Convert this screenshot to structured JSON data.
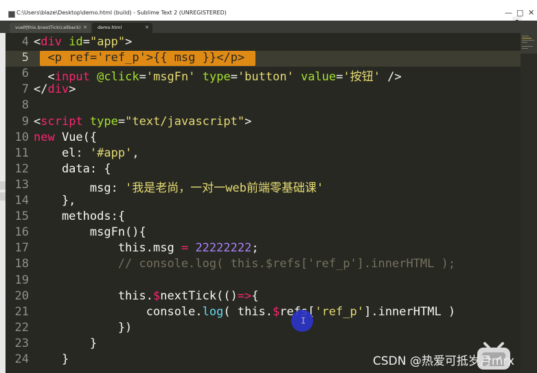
{
  "window": {
    "title": "C:\\Users\\blaze\\Desktop\\demo.html (build) - Sublime Text 2 (UNREGISTERED)",
    "controls": {
      "minimize": "—",
      "maximize": "□",
      "close": "✕"
    }
  },
  "tabs": [
    {
      "label": "vue时this.$nextTick(callback)",
      "close": "✕",
      "active": false
    },
    {
      "label": "demo.html",
      "close": "✕",
      "active": true
    }
  ],
  "editor": {
    "current_line": "5",
    "lines": [
      {
        "n": "4",
        "tokens": [
          {
            "t": "<",
            "c": "t-plain"
          },
          {
            "t": "div",
            "c": "t-tag"
          },
          {
            "t": " ",
            "c": "t-plain"
          },
          {
            "t": "id",
            "c": "t-attr"
          },
          {
            "t": "=",
            "c": "t-plain"
          },
          {
            "t": "\"app\"",
            "c": "t-str"
          },
          {
            "t": ">",
            "c": "t-plain"
          }
        ]
      },
      {
        "n": "5",
        "tokens": [
          {
            "t": "  ",
            "c": "t-plain"
          },
          {
            "t": "<",
            "c": "t-plain"
          },
          {
            "t": "p",
            "c": "t-tag"
          },
          {
            "t": " ",
            "c": "t-plain"
          },
          {
            "t": "ref",
            "c": "t-attr"
          },
          {
            "t": "=",
            "c": "t-plain"
          },
          {
            "t": "'ref_p'",
            "c": "t-str"
          },
          {
            "t": ">{{ msg }}</",
            "c": "t-plain"
          },
          {
            "t": "p",
            "c": "t-tag"
          },
          {
            "t": ">",
            "c": "t-plain"
          }
        ]
      },
      {
        "n": "6",
        "tokens": [
          {
            "t": "  <",
            "c": "t-plain"
          },
          {
            "t": "input",
            "c": "t-tag"
          },
          {
            "t": " ",
            "c": "t-plain"
          },
          {
            "t": "@click",
            "c": "t-attr"
          },
          {
            "t": "=",
            "c": "t-plain"
          },
          {
            "t": "'msgFn'",
            "c": "t-str"
          },
          {
            "t": " ",
            "c": "t-plain"
          },
          {
            "t": "type",
            "c": "t-attr"
          },
          {
            "t": "=",
            "c": "t-plain"
          },
          {
            "t": "'button'",
            "c": "t-str"
          },
          {
            "t": " ",
            "c": "t-plain"
          },
          {
            "t": "value",
            "c": "t-attr"
          },
          {
            "t": "=",
            "c": "t-plain"
          },
          {
            "t": "'按钮'",
            "c": "t-str"
          },
          {
            "t": " />",
            "c": "t-plain"
          }
        ]
      },
      {
        "n": "7",
        "tokens": [
          {
            "t": "</",
            "c": "t-plain"
          },
          {
            "t": "div",
            "c": "t-tag"
          },
          {
            "t": ">",
            "c": "t-plain"
          }
        ]
      },
      {
        "n": "8",
        "tokens": []
      },
      {
        "n": "9",
        "tokens": [
          {
            "t": "<",
            "c": "t-plain"
          },
          {
            "t": "script",
            "c": "t-tag"
          },
          {
            "t": " ",
            "c": "t-plain"
          },
          {
            "t": "type",
            "c": "t-attr"
          },
          {
            "t": "=",
            "c": "t-plain"
          },
          {
            "t": "\"text/javascript\"",
            "c": "t-str"
          },
          {
            "t": ">",
            "c": "t-plain"
          }
        ]
      },
      {
        "n": "10",
        "tokens": [
          {
            "t": "new",
            "c": "t-kw"
          },
          {
            "t": " Vue({",
            "c": "t-plain"
          }
        ]
      },
      {
        "n": "11",
        "tokens": [
          {
            "t": "    el: ",
            "c": "t-plain"
          },
          {
            "t": "'#app'",
            "c": "t-str"
          },
          {
            "t": ",",
            "c": "t-plain"
          }
        ]
      },
      {
        "n": "12",
        "tokens": [
          {
            "t": "    data: {",
            "c": "t-plain"
          }
        ]
      },
      {
        "n": "13",
        "tokens": [
          {
            "t": "        msg: ",
            "c": "t-plain"
          },
          {
            "t": "'我是老尚，一对一web前端零基础课'",
            "c": "t-str"
          }
        ]
      },
      {
        "n": "14",
        "tokens": [
          {
            "t": "    },",
            "c": "t-plain"
          }
        ]
      },
      {
        "n": "15",
        "tokens": [
          {
            "t": "    methods:{",
            "c": "t-plain"
          }
        ]
      },
      {
        "n": "16",
        "tokens": [
          {
            "t": "        msgFn(){",
            "c": "t-plain"
          }
        ]
      },
      {
        "n": "17",
        "tokens": [
          {
            "t": "            this.msg ",
            "c": "t-plain"
          },
          {
            "t": "=",
            "c": "t-kw"
          },
          {
            "t": " ",
            "c": "t-plain"
          },
          {
            "t": "22222222",
            "c": "t-num"
          },
          {
            "t": ";",
            "c": "t-plain"
          }
        ]
      },
      {
        "n": "18",
        "tokens": [
          {
            "t": "            // console.log( this.$refs['ref_p'].innerHTML );",
            "c": "t-com"
          }
        ]
      },
      {
        "n": "19",
        "tokens": []
      },
      {
        "n": "20",
        "tokens": [
          {
            "t": "            this.",
            "c": "t-plain"
          },
          {
            "t": "$",
            "c": "t-kw"
          },
          {
            "t": "nextTick(()",
            "c": "t-plain"
          },
          {
            "t": "=>",
            "c": "t-kw"
          },
          {
            "t": "{",
            "c": "t-plain"
          }
        ]
      },
      {
        "n": "21",
        "tokens": [
          {
            "t": "                console.",
            "c": "t-plain"
          },
          {
            "t": "log",
            "c": "t-cls"
          },
          {
            "t": "( this.",
            "c": "t-plain"
          },
          {
            "t": "$",
            "c": "t-kw"
          },
          {
            "t": "refs[",
            "c": "t-plain"
          },
          {
            "t": "'ref_p'",
            "c": "t-str"
          },
          {
            "t": "].innerHTML )",
            "c": "t-plain"
          }
        ]
      },
      {
        "n": "22",
        "tokens": [
          {
            "t": "            })",
            "c": "t-plain"
          }
        ]
      },
      {
        "n": "23",
        "tokens": [
          {
            "t": "        }",
            "c": "t-plain"
          }
        ]
      },
      {
        "n": "24",
        "tokens": [
          {
            "t": "    }",
            "c": "t-plain"
          }
        ]
      }
    ]
  },
  "overlay": {
    "watermark": "CSDN @热爱可抵岁月mrx",
    "cursor_glyph": "I"
  },
  "colors": {
    "background": "#272822",
    "selection": "#e08a16",
    "tag": "#f92672",
    "attr": "#a6e22e",
    "string": "#e6db74",
    "number": "#ae81ff",
    "comment": "#75715e"
  }
}
